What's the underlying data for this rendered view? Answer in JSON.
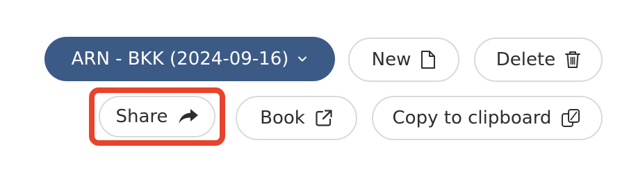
{
  "route_selector": {
    "label": "ARN - BKK (2024-09-16)",
    "icon": "chevron-down-icon",
    "bg_color": "#3c5a86"
  },
  "actions": {
    "new_label": "New",
    "new_icon": "file-icon",
    "delete_label": "Delete",
    "delete_icon": "trash-icon",
    "share_label": "Share",
    "share_icon": "share-arrow-icon",
    "book_label": "Book",
    "book_icon": "external-link-icon",
    "copy_label": "Copy to clipboard",
    "copy_icon": "clipboard-copy-icon"
  },
  "highlight_color": "#e8432d"
}
